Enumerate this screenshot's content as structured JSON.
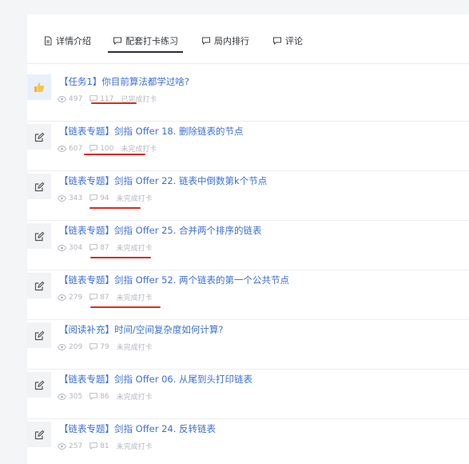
{
  "tabs": [
    {
      "label": "详情介绍",
      "icon": "document-icon"
    },
    {
      "label": "配套打卡练习",
      "icon": "comment-icon",
      "active": true
    },
    {
      "label": "局内排行",
      "icon": "comment-icon"
    },
    {
      "label": "评论",
      "icon": "comment-icon"
    }
  ],
  "items": [
    {
      "title": "【任务1】你目前算法都学过啥?",
      "views": "497",
      "comments": "117",
      "status": "已完成打卡",
      "icon": "thumbs-up-icon"
    },
    {
      "title": "【链表专题】剑指 Offer 18. 删除链表的节点",
      "views": "607",
      "comments": "100",
      "status": "未完成打卡",
      "icon": "edit-icon"
    },
    {
      "title": "【链表专题】剑指 Offer 22. 链表中倒数第k个节点",
      "views": "343",
      "comments": "94",
      "status": "未完成打卡",
      "icon": "edit-icon"
    },
    {
      "title": "【链表专题】剑指 Offer 25. 合并两个排序的链表",
      "views": "304",
      "comments": "87",
      "status": "未完成打卡",
      "icon": "edit-icon"
    },
    {
      "title": "【链表专题】剑指 Offer 52. 两个链表的第一个公共节点",
      "views": "279",
      "comments": "87",
      "status": "未完成打卡",
      "icon": "edit-icon"
    },
    {
      "title": "【阅读补充】时间/空间复杂度如何计算?",
      "views": "209",
      "comments": "79",
      "status": "未完成打卡",
      "icon": "edit-icon"
    },
    {
      "title": "【链表专题】剑指 Offer 06. 从尾到头打印链表",
      "views": "305",
      "comments": "86",
      "status": "未完成打卡",
      "icon": "edit-icon"
    },
    {
      "title": "【链表专题】剑指 Offer 24. 反转链表",
      "views": "257",
      "comments": "81",
      "status": "未完成打卡",
      "icon": "edit-icon"
    }
  ],
  "colors": {
    "link": "#3c6fd6",
    "meta": "#b3b7be",
    "annotation": "#e02a1f"
  }
}
